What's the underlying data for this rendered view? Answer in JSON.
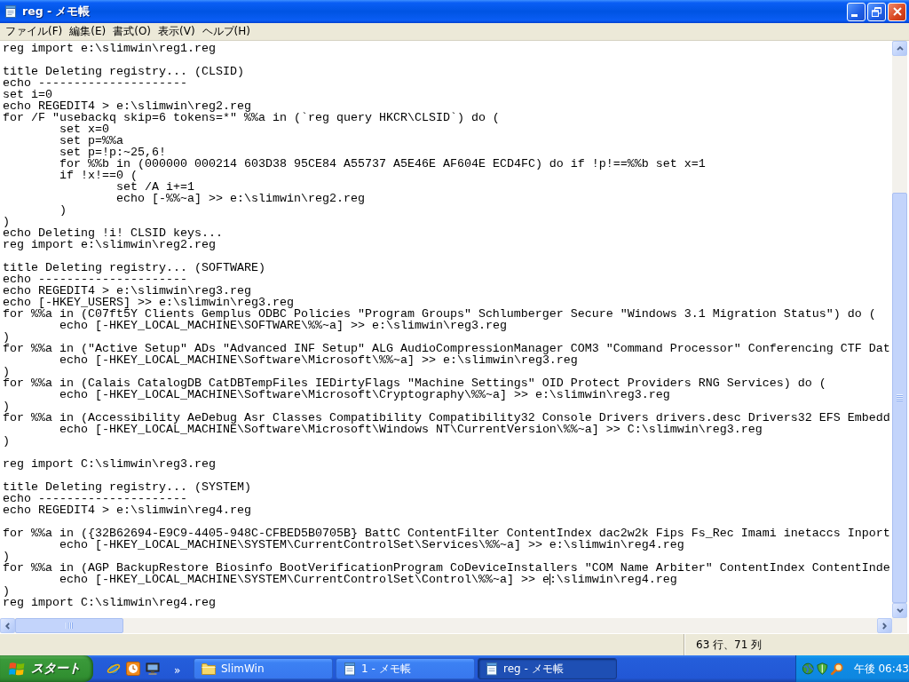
{
  "window": {
    "title": "reg - メモ帳"
  },
  "menu": [
    "ファイル(F)",
    "編集(E)",
    "書式(O)",
    "表示(V)",
    "ヘルプ(H)"
  ],
  "editor": {
    "blocks": [
      [
        "reg import e:\\slimwin\\reg1.reg"
      ],
      [
        "title Deleting registry... (CLSID)",
        "echo ---------------------",
        "set i=0",
        "echo REGEDIT4 > e:\\slimwin\\reg2.reg",
        "for /F \"usebackq skip=6 tokens=*\" %%a in (`reg query HKCR\\CLSID`) do (",
        "\tset x=0",
        "\tset p=%%a",
        "\tset p=!p:~25,6!",
        "\tfor %%b in (000000 000214 603D38 95CE84 A55737 A5E46E AF604E ECD4FC) do if !p!==%%b set x=1",
        "\tif !x!==0 (",
        "\t\tset /A i+=1",
        "\t\techo [-%%~a] >> e:\\slimwin\\reg2.reg",
        "\t)",
        ")",
        "echo Deleting !i! CLSID keys...",
        "reg import e:\\slimwin\\reg2.reg"
      ],
      [
        "title Deleting registry... (SOFTWARE)",
        "echo ---------------------",
        "echo REGEDIT4 > e:\\slimwin\\reg3.reg",
        "echo [-HKEY_USERS] >> e:\\slimwin\\reg3.reg",
        "for %%a in (C07ft5Y Clients Gemplus ODBC Policies \"Program Groups\" Schlumberger Secure \"Windows 3.1 Migration Status\") do (",
        "\techo [-HKEY_LOCAL_MACHINE\\SOFTWARE\\%%~a] >> e:\\slimwin\\reg3.reg",
        ")",
        "for %%a in (\"Active Setup\" ADs \"Advanced INF Setup\" ALG AudioCompressionManager COM3 \"Command Processor\" Conferencing CTF Dat",
        "\techo [-HKEY_LOCAL_MACHINE\\Software\\Microsoft\\%%~a] >> e:\\slimwin\\reg3.reg",
        ")",
        "for %%a in (Calais CatalogDB CatDBTempFiles IEDirtyFlags \"Machine Settings\" OID Protect Providers RNG Services) do (",
        "\techo [-HKEY_LOCAL_MACHINE\\Software\\Microsoft\\Cryptography\\%%~a] >> e:\\slimwin\\reg3.reg",
        ")",
        "for %%a in (Accessibility AeDebug Asr Classes Compatibility Compatibility32 Console Drivers drivers.desc Drivers32 EFS Embedd",
        "\techo [-HKEY_LOCAL_MACHINE\\Software\\Microsoft\\Windows NT\\CurrentVersion\\%%~a] >> C:\\slimwin\\reg3.reg",
        ")"
      ],
      [
        "reg import C:\\slimwin\\reg3.reg"
      ],
      [
        "title Deleting registry... (SYSTEM)",
        "echo ---------------------",
        "echo REGEDIT4 > e:\\slimwin\\reg4.reg"
      ],
      [
        "for %%a in ({32B62694-E9C9-4405-948C-CFBED5B0705B} BattC ContentFilter ContentIndex dac2w2k Fips Fs_Rec Imami inetaccs Inport",
        "\techo [-HKEY_LOCAL_MACHINE\\SYSTEM\\CurrentControlSet\\Services\\%%~a] >> e:\\slimwin\\reg4.reg",
        ")",
        "for %%a in (AGP BackupRestore Biosinfo BootVerificationProgram CoDeviceInstallers \"COM Name Arbiter\" ContentIndex ContentInde",
        {
          "before_caret": "\techo [-HKEY_LOCAL_MACHINE\\SYSTEM\\CurrentControlSet\\Control\\%%~a] >> e",
          "after_caret": ":\\slimwin\\reg4.reg"
        },
        ")",
        "reg import C:\\slimwin\\reg4.reg"
      ]
    ]
  },
  "status_bar": {
    "position": "63 行、71 列"
  },
  "taskbar": {
    "start_label": "スタート",
    "quick_launch_more": "»",
    "tasks": [
      {
        "label": "SlimWin",
        "kind": "folder",
        "selected": false
      },
      {
        "label": "1 - メモ帳",
        "kind": "notepad",
        "selected": false
      },
      {
        "label": "reg - メモ帳",
        "kind": "notepad",
        "selected": true
      }
    ],
    "clock": "午後 06:43"
  }
}
